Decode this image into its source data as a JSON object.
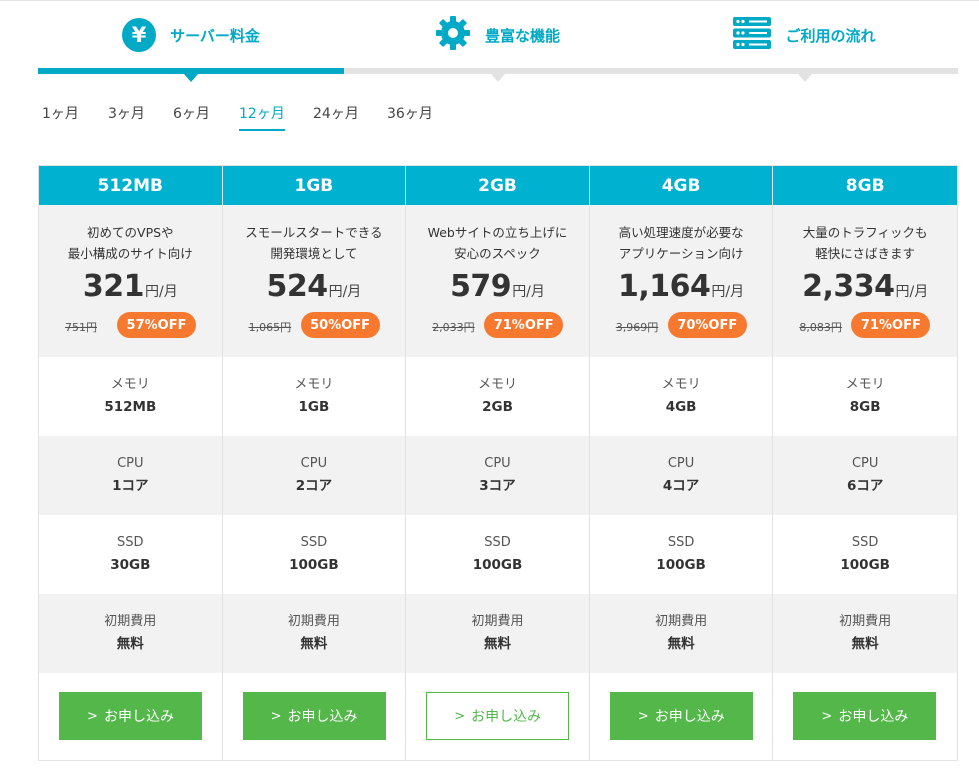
{
  "tabs": [
    {
      "label": "サーバー料金",
      "icon": "yen-icon",
      "active": true
    },
    {
      "label": "豊富な機能",
      "icon": "gear-icon",
      "active": false
    },
    {
      "label": "ご利用の流れ",
      "icon": "server-icon",
      "active": false
    }
  ],
  "yen_symbol": "¥",
  "periods": [
    "1ヶ月",
    "3ヶ月",
    "6ヶ月",
    "12ヶ月",
    "24ヶ月",
    "36ヶ月"
  ],
  "selected_period": "12ヶ月",
  "colors": {
    "accent": "#00a9c6",
    "header": "#00b1d0",
    "badge": "#f7782f",
    "button": "#53b74a"
  },
  "unit": "円/月",
  "spec_labels": {
    "memory": "メモリ",
    "cpu": "CPU",
    "ssd": "SSD",
    "initial": "初期費用"
  },
  "plans": [
    {
      "name": "512MB",
      "desc1": "初めてのVPSや",
      "desc2": "最小構成のサイト向け",
      "price": "321",
      "old_price": "751円",
      "discount": "57%OFF",
      "memory": "512MB",
      "cpu": "1コア",
      "ssd": "30GB",
      "initial": "無料",
      "button": "お申し込み",
      "button_style": "filled"
    },
    {
      "name": "1GB",
      "desc1": "スモールスタートできる",
      "desc2": "開発環境として",
      "price": "524",
      "old_price": "1,065円",
      "discount": "50%OFF",
      "memory": "1GB",
      "cpu": "2コア",
      "ssd": "100GB",
      "initial": "無料",
      "button": "お申し込み",
      "button_style": "filled"
    },
    {
      "name": "2GB",
      "desc1": "Webサイトの立ち上げに",
      "desc2": "安心のスペック",
      "price": "579",
      "old_price": "2,033円",
      "discount": "71%OFF",
      "memory": "2GB",
      "cpu": "3コア",
      "ssd": "100GB",
      "initial": "無料",
      "button": "お申し込み",
      "button_style": "outline"
    },
    {
      "name": "4GB",
      "desc1": "高い処理速度が必要な",
      "desc2": "アプリケーション向け",
      "price": "1,164",
      "old_price": "3,969円",
      "discount": "70%OFF",
      "memory": "4GB",
      "cpu": "4コア",
      "ssd": "100GB",
      "initial": "無料",
      "button": "お申し込み",
      "button_style": "filled"
    },
    {
      "name": "8GB",
      "desc1": "大量のトラフィックも",
      "desc2": "軽快にさばきます",
      "price": "2,334",
      "old_price": "8,083円",
      "discount": "71%OFF",
      "memory": "8GB",
      "cpu": "6コア",
      "ssd": "100GB",
      "initial": "無料",
      "button": "お申し込み",
      "button_style": "filled"
    }
  ]
}
